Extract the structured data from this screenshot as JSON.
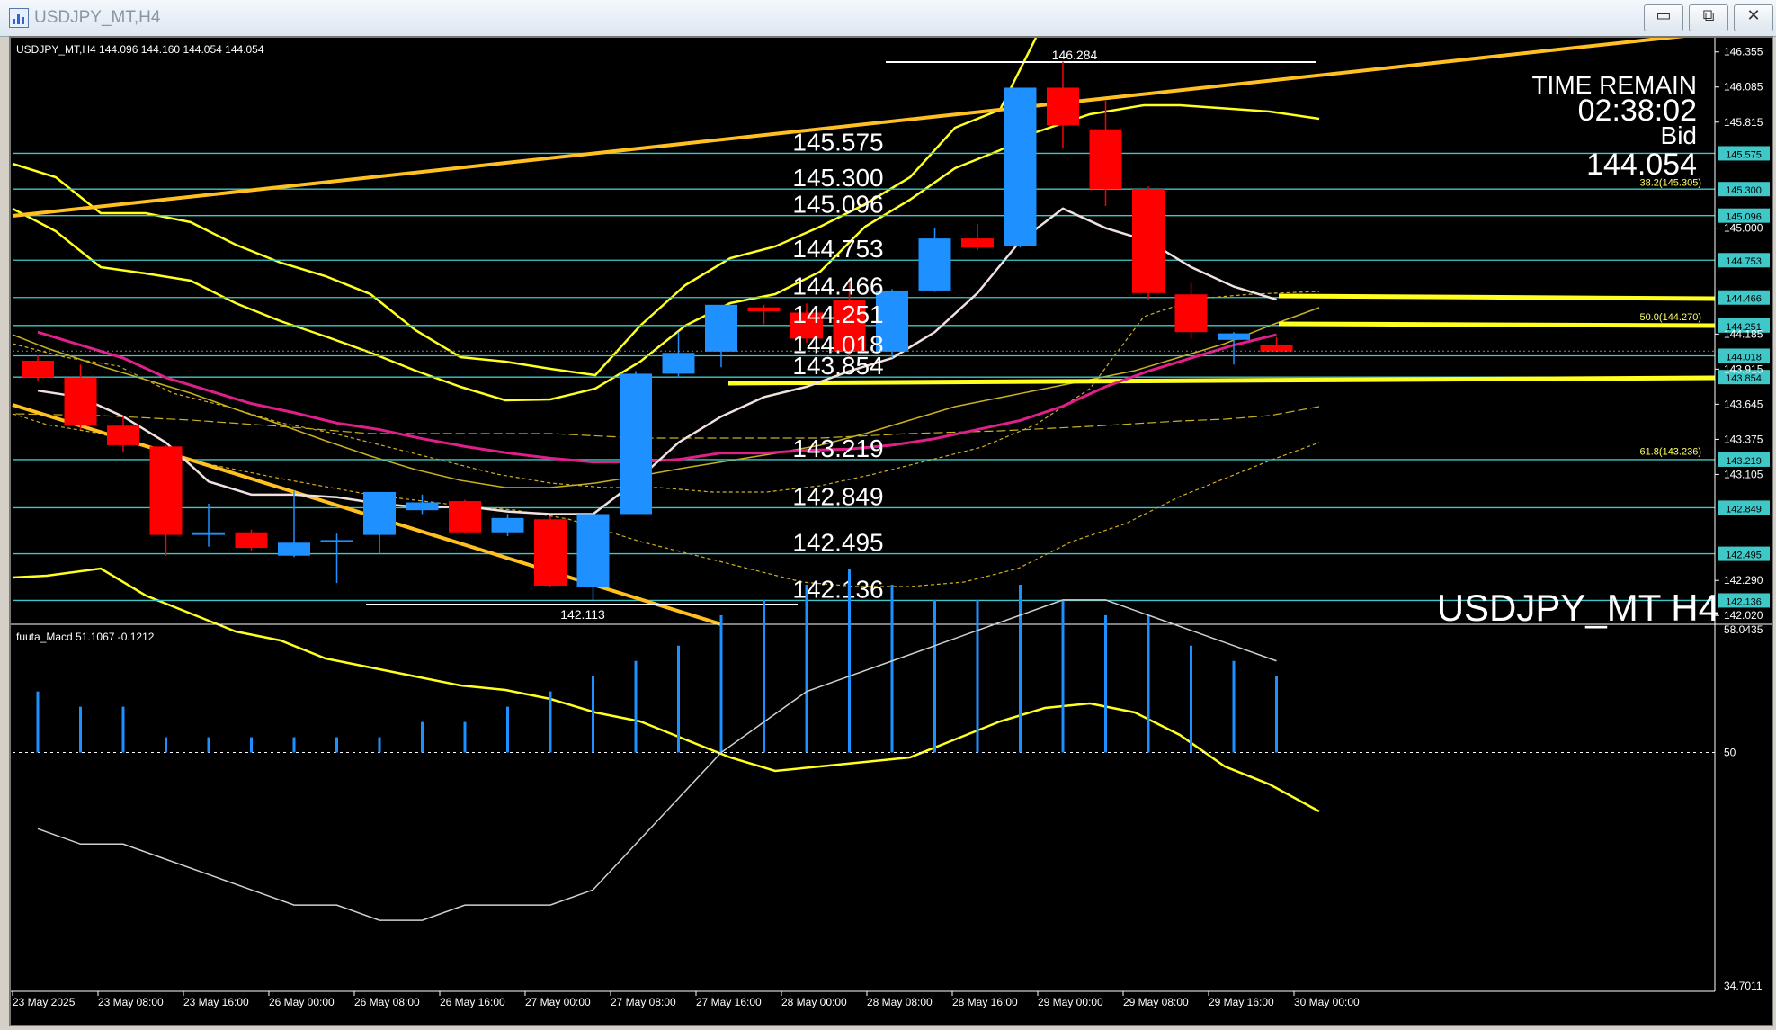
{
  "window": {
    "title": "USDJPY_MT,H4",
    "minimize_icon": "minimize-icon",
    "restore_icon": "restore-icon",
    "close_icon": "close-icon",
    "app_icon": "chart-window-icon"
  },
  "chart_info": {
    "header": "USDJPY_MT,H4  144.096 144.160 144.054 144.054",
    "watermark": "USDJPY_MT H4",
    "high_label": "146.284",
    "low_label": "142.113"
  },
  "time_remain": {
    "title": "TIME REMAIN",
    "time": "02:38:02",
    "bid_label": "Bid",
    "bid_value": "144.054"
  },
  "macd": {
    "label": "fuuta_Macd 51.1067  -0.1212",
    "axis_labels": [
      "58.0435",
      "50",
      "34.7011"
    ]
  },
  "colors": {
    "background": "#000000",
    "bull": "#1e90ff",
    "bear": "#ff0000",
    "level_line": "#40c8c8",
    "trend_line": "#ffc020",
    "bollinger": "#ffff20",
    "ma_fast": "#f0e0e0",
    "ma_slow": "#e0208a",
    "text": "#ffffff"
  },
  "chart_data": {
    "type": "candlestick",
    "symbol": "USDJPY_MT",
    "timeframe": "H4",
    "x_labels": [
      "23 May 2025",
      "23 May 08:00",
      "23 May 16:00",
      "26 May 00:00",
      "26 May 08:00",
      "26 May 16:00",
      "27 May 00:00",
      "27 May 08:00",
      "27 May 16:00",
      "28 May 00:00",
      "28 May 08:00",
      "28 May 16:00",
      "29 May 00:00",
      "29 May 08:00",
      "29 May 16:00",
      "30 May 00:00"
    ],
    "y_ticks": [
      "146.355",
      "146.085",
      "145.815",
      "145.000",
      "144.185",
      "143.915",
      "143.645",
      "143.375",
      "143.105",
      "142.290",
      "142.020"
    ],
    "ylim": [
      141.98,
      146.45
    ],
    "candles": [
      {
        "o": 143.98,
        "h": 144.02,
        "l": 143.82,
        "c": 143.85
      },
      {
        "o": 143.85,
        "h": 143.95,
        "l": 143.45,
        "c": 143.48
      },
      {
        "o": 143.48,
        "h": 143.55,
        "l": 143.28,
        "c": 143.33
      },
      {
        "o": 143.32,
        "h": 143.33,
        "l": 142.48,
        "c": 142.64
      },
      {
        "o": 142.64,
        "h": 142.88,
        "l": 142.55,
        "c": 142.66
      },
      {
        "o": 142.66,
        "h": 142.68,
        "l": 142.52,
        "c": 142.54
      },
      {
        "o": 142.48,
        "h": 142.98,
        "l": 142.47,
        "c": 142.58
      },
      {
        "o": 142.6,
        "h": 142.65,
        "l": 142.27,
        "c": 142.6
      },
      {
        "o": 142.64,
        "h": 142.97,
        "l": 142.49,
        "c": 142.97
      },
      {
        "o": 142.83,
        "h": 142.95,
        "l": 142.8,
        "c": 142.89
      },
      {
        "o": 142.9,
        "h": 142.91,
        "l": 142.65,
        "c": 142.66
      },
      {
        "o": 142.66,
        "h": 142.8,
        "l": 142.63,
        "c": 142.77
      },
      {
        "o": 142.76,
        "h": 142.78,
        "l": 142.24,
        "c": 142.25
      },
      {
        "o": 142.24,
        "h": 142.8,
        "l": 142.13,
        "c": 142.8
      },
      {
        "o": 142.8,
        "h": 143.9,
        "l": 142.8,
        "c": 143.88
      },
      {
        "o": 143.88,
        "h": 144.2,
        "l": 143.85,
        "c": 144.04
      },
      {
        "o": 144.05,
        "h": 144.4,
        "l": 143.93,
        "c": 144.41
      },
      {
        "o": 144.39,
        "h": 144.41,
        "l": 144.26,
        "c": 144.36
      },
      {
        "o": 144.35,
        "h": 144.42,
        "l": 144.12,
        "c": 144.15
      },
      {
        "o": 144.45,
        "h": 144.58,
        "l": 144.0,
        "c": 144.05
      },
      {
        "o": 144.05,
        "h": 144.53,
        "l": 144.0,
        "c": 144.52
      },
      {
        "o": 144.52,
        "h": 145.0,
        "l": 144.51,
        "c": 144.92
      },
      {
        "o": 144.92,
        "h": 145.03,
        "l": 144.83,
        "c": 144.85
      },
      {
        "o": 144.86,
        "h": 146.08,
        "l": 144.85,
        "c": 146.08
      },
      {
        "o": 146.08,
        "h": 146.28,
        "l": 145.62,
        "c": 145.79
      },
      {
        "o": 145.76,
        "h": 145.98,
        "l": 145.17,
        "c": 145.3
      },
      {
        "o": 145.3,
        "h": 145.32,
        "l": 144.45,
        "c": 144.5
      },
      {
        "o": 144.49,
        "h": 144.58,
        "l": 144.15,
        "c": 144.2
      },
      {
        "o": 144.14,
        "h": 144.2,
        "l": 143.95,
        "c": 144.19
      },
      {
        "o": 144.1,
        "h": 144.16,
        "l": 144.05,
        "c": 144.05
      }
    ],
    "levels": [
      {
        "value": 145.575,
        "label": "145.575"
      },
      {
        "value": 145.3,
        "label": "145.300"
      },
      {
        "value": 145.096,
        "label": "145.096"
      },
      {
        "value": 144.753,
        "label": "144.753"
      },
      {
        "value": 144.466,
        "label": "144.466"
      },
      {
        "value": 144.251,
        "label": "144.251"
      },
      {
        "value": 144.018,
        "label": "144.018"
      },
      {
        "value": 143.854,
        "label": "143.854"
      },
      {
        "value": 143.219,
        "label": "143.219"
      },
      {
        "value": 142.849,
        "label": "142.849"
      },
      {
        "value": 142.495,
        "label": "142.495"
      },
      {
        "value": 142.136,
        "label": "142.136"
      }
    ],
    "fib_labels": [
      {
        "value": 145.305,
        "label": "38.2(145.305)"
      },
      {
        "value": 144.27,
        "label": "50.0(144.270)"
      },
      {
        "value": 143.236,
        "label": "61.8(143.236)"
      }
    ],
    "bid": 144.054,
    "ma_fast": [
      143.75,
      143.7,
      143.55,
      143.35,
      143.05,
      142.95,
      142.95,
      142.93,
      142.88,
      142.85,
      142.86,
      142.82,
      142.8,
      142.8,
      143.05,
      143.35,
      143.55,
      143.7,
      143.78,
      143.9,
      144.0,
      144.2,
      144.5,
      144.9,
      145.15,
      145.0,
      144.9,
      144.7,
      144.55,
      144.45
    ],
    "ma_slow": [
      144.2,
      144.1,
      144.0,
      143.85,
      143.75,
      143.65,
      143.58,
      143.5,
      143.45,
      143.38,
      143.32,
      143.27,
      143.23,
      143.2,
      143.2,
      143.22,
      143.27,
      143.27,
      143.29,
      143.3,
      143.33,
      143.38,
      143.45,
      143.52,
      143.63,
      143.78,
      143.9,
      144.0,
      144.1,
      144.18
    ],
    "macd_hist": [
      54,
      53,
      53,
      51,
      51,
      51,
      51,
      51,
      51,
      52,
      52,
      53,
      54,
      55,
      56,
      57,
      59,
      60,
      61,
      62,
      61,
      60,
      60,
      61,
      60,
      59,
      59,
      57,
      56,
      55
    ],
    "macd_signal": [
      45,
      44,
      44,
      43,
      42,
      41,
      40,
      40,
      39,
      39,
      40,
      40,
      40,
      41,
      44,
      47,
      50,
      52,
      54,
      55,
      56,
      57,
      58,
      59,
      60,
      60,
      59,
      58,
      57,
      56
    ]
  }
}
